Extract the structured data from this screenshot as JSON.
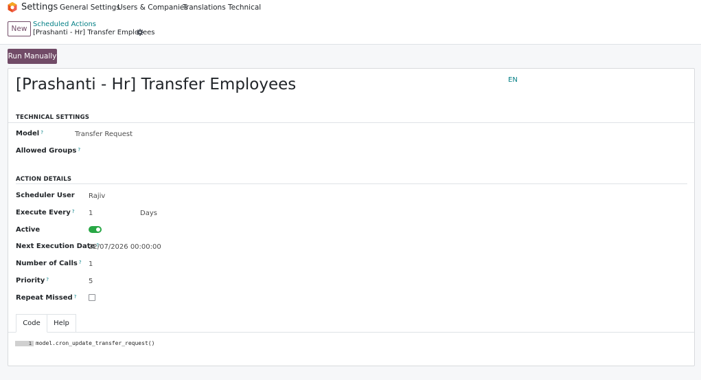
{
  "navbar": {
    "app_name": "Settings",
    "menus": [
      "General Settings",
      "Users & Companies",
      "Translations",
      "Technical"
    ]
  },
  "control": {
    "new_label": "New",
    "breadcrumb_parent": "Scheduled Actions",
    "breadcrumb_current": "[Prashanti - Hr] Transfer Employees"
  },
  "actions": {
    "run_manually": "Run Manually"
  },
  "form": {
    "title": "[Prashanti - Hr] Transfer Employees",
    "lang": "EN",
    "technical_settings": {
      "heading": "TECHNICAL SETTINGS",
      "model_label": "Model",
      "model_value": "Transfer Request",
      "groups_label": "Allowed Groups"
    },
    "action_details": {
      "heading": "ACTION DETAILS",
      "scheduler_user_label": "Scheduler User",
      "scheduler_user_value": "Rajiv",
      "execute_every_label": "Execute Every",
      "execute_every_value": "1",
      "execute_every_unit": "Days",
      "active_label": "Active",
      "active_value": true,
      "next_execution_label": "Next Execution Date",
      "next_execution_value": "22/07/2026 00:00:00",
      "number_of_calls_label": "Number of Calls",
      "number_of_calls_value": "1",
      "priority_label": "Priority",
      "priority_value": "5",
      "repeat_missed_label": "Repeat Missed",
      "repeat_missed_value": false
    },
    "help_marker": "?",
    "tabs": [
      "Code",
      "Help"
    ],
    "code": {
      "line_number": "1",
      "line": "model.cron_update_transfer_request()"
    }
  },
  "colors": {
    "brand": "#714b67",
    "link": "#017e84",
    "toggle_on": "#28a745"
  }
}
